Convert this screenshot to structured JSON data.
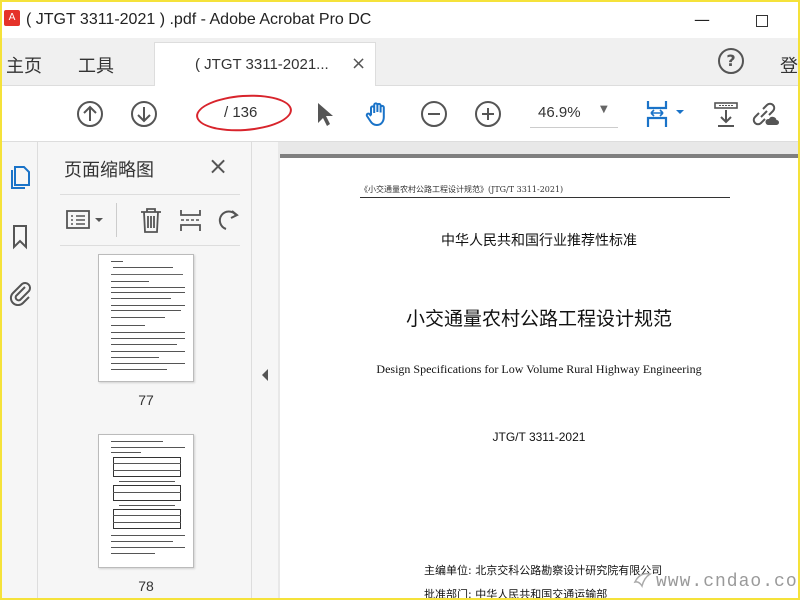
{
  "window": {
    "title": "( JTGT 3311-2021 ) .pdf - Adobe Acrobat Pro DC",
    "minimize": "—",
    "app_icon_text": "A"
  },
  "tabs": {
    "home": "主页",
    "tools": "工具",
    "document": "( JTGT 3311-2021...",
    "close": "×",
    "help": "?",
    "login": "登"
  },
  "toolbar": {
    "current_page": "",
    "page_total": "/ 136",
    "zoom": "46.9%",
    "zoom_arrow": "▼"
  },
  "thumbnail_pane": {
    "title": "页面缩略图",
    "close": "×",
    "thumbnails": [
      {
        "page": "77"
      },
      {
        "page": "78"
      }
    ],
    "scroll_up": "∧",
    "scroll_down": "∨"
  },
  "document": {
    "running_header": "《小交通量农村公路工程设计规范》(JTG/T 3311-2021)",
    "category": "中华人民共和国行业推荐性标准",
    "title_cn": "小交通量农村公路工程设计规范",
    "title_en": "Design Specifications for Low Volume Rural Highway Engineering",
    "code": "JTG/T  3311-2021",
    "chief_editor": "主编单位: 北京交科公路勘察设计研究院有限公司",
    "approved_by": "批准部门: 中华人民共和国交通运输部"
  },
  "watermark": "www.cndao.com",
  "colors": {
    "frame": "#f5e23a",
    "accent_blue": "#1a73c8",
    "annotation_red": "#d8242c"
  }
}
